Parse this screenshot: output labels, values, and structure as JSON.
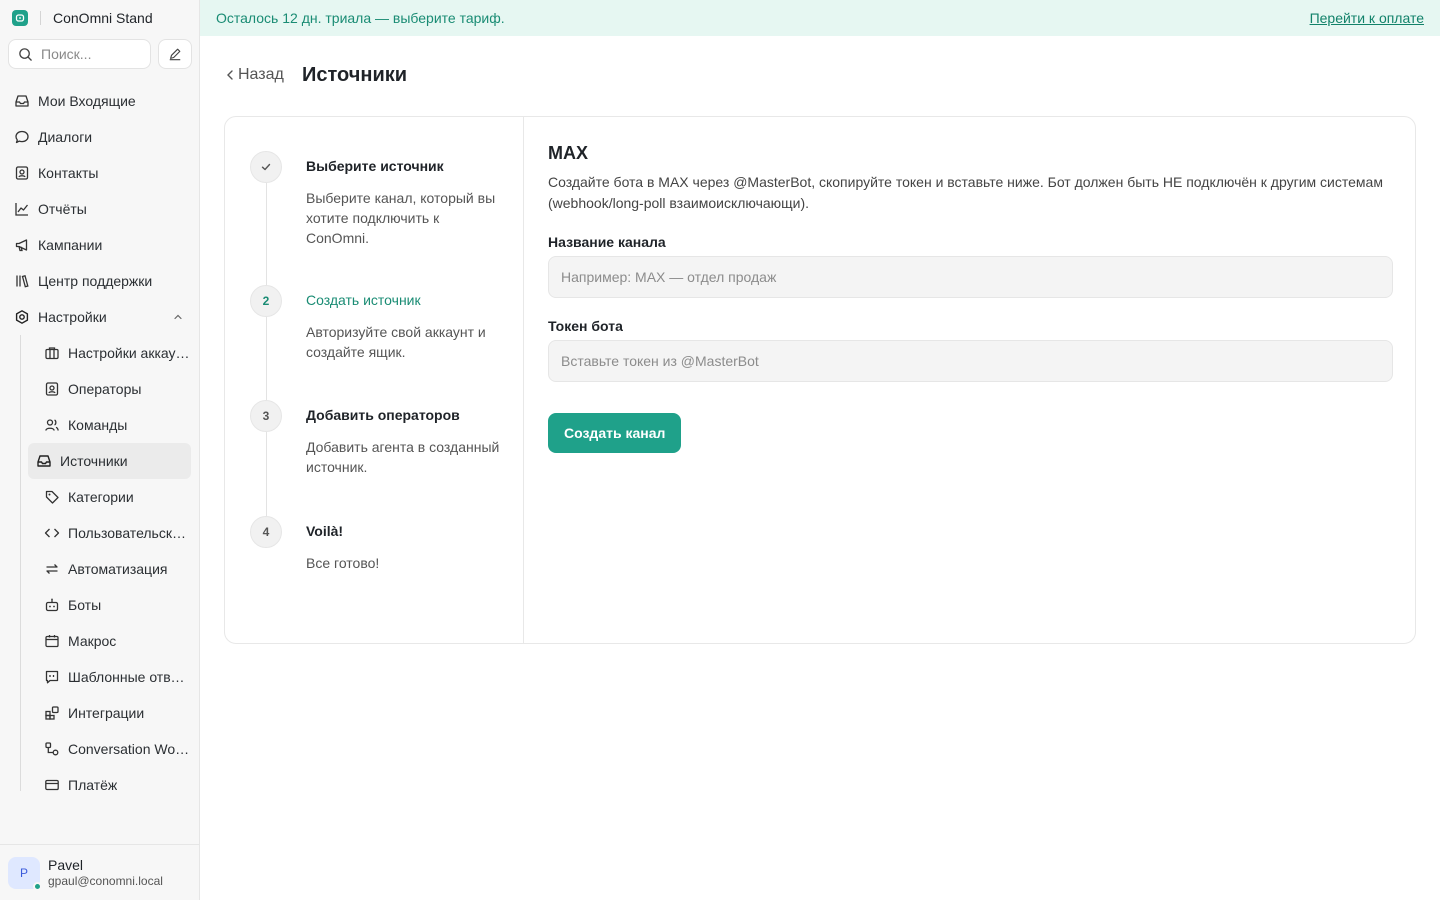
{
  "brand": {
    "name": "ConOmni Stand",
    "icon": "chat-logo-icon",
    "color": "#1fa18a"
  },
  "search": {
    "placeholder": "Поиск..."
  },
  "nav": [
    {
      "label": "Мои Входящие",
      "icon": "inbox-icon"
    },
    {
      "label": "Диалоги",
      "icon": "chat-bubble-icon"
    },
    {
      "label": "Контакты",
      "icon": "contact-card-icon"
    },
    {
      "label": "Отчёты",
      "icon": "chart-line-icon"
    },
    {
      "label": "Кампании",
      "icon": "megaphone-icon"
    },
    {
      "label": "Центр поддержки",
      "icon": "library-icon"
    },
    {
      "label": "Настройки",
      "icon": "settings-icon",
      "expanded": true
    }
  ],
  "settings_sub": [
    {
      "label": "Настройки аккаунта",
      "icon": "briefcase-icon"
    },
    {
      "label": "Операторы",
      "icon": "contact-card-icon"
    },
    {
      "label": "Команды",
      "icon": "users-icon"
    },
    {
      "label": "Источники",
      "icon": "inbox-icon",
      "active": true
    },
    {
      "label": "Категории",
      "icon": "tag-icon"
    },
    {
      "label": "Пользовательские атрибуты",
      "icon": "code-icon"
    },
    {
      "label": "Автоматизация",
      "icon": "arrows-swap-icon"
    },
    {
      "label": "Боты",
      "icon": "bot-icon"
    },
    {
      "label": "Макрос",
      "icon": "calendar-icon"
    },
    {
      "label": "Шаблонные ответы",
      "icon": "quote-box-icon"
    },
    {
      "label": "Интеграции",
      "icon": "grid-plus-icon"
    },
    {
      "label": "Conversation Workflows",
      "icon": "workflow-icon"
    },
    {
      "label": "Платёж",
      "icon": "credit-card-icon"
    }
  ],
  "profile": {
    "initial": "P",
    "name": "Pavel",
    "email": "gpaul@conomni.local",
    "status_color": "#1fa18a"
  },
  "banner": {
    "text": "Осталось 12 дн. триала — выберите тариф.",
    "link": "Перейти к оплате"
  },
  "header": {
    "back": "Назад",
    "title": "Источники"
  },
  "steps": [
    {
      "number": "",
      "done": true,
      "title": "Выберите источник",
      "desc": "Выберите канал, который вы хотите подключить к ConOmni."
    },
    {
      "number": "2",
      "current": true,
      "title": "Создать источник",
      "desc": "Авторизуйте свой аккаунт и создайте ящик."
    },
    {
      "number": "3",
      "title": "Добавить операторов",
      "desc": "Добавить агента в созданный источник."
    },
    {
      "number": "4",
      "title": "Voilà!",
      "desc": "Все готово!"
    }
  ],
  "form": {
    "title": "MAX",
    "description": "Создайте бота в MAX через @MasterBot, скопируйте токен и вставьте ниже. Бот должен быть НЕ подключён к другим системам (webhook/long-poll взаимоисключающи).",
    "channel_label": "Название канала",
    "channel_value": "",
    "channel_placeholder": "Например: MAX — отдел продаж",
    "token_label": "Токен бота",
    "token_value": "",
    "token_placeholder": "Вставьте токен из @MasterBot",
    "submit": "Создать канал"
  },
  "colors": {
    "accent": "#1fa18a",
    "banner_bg": "#e6f7f2",
    "banner_text": "#1a8c74"
  }
}
